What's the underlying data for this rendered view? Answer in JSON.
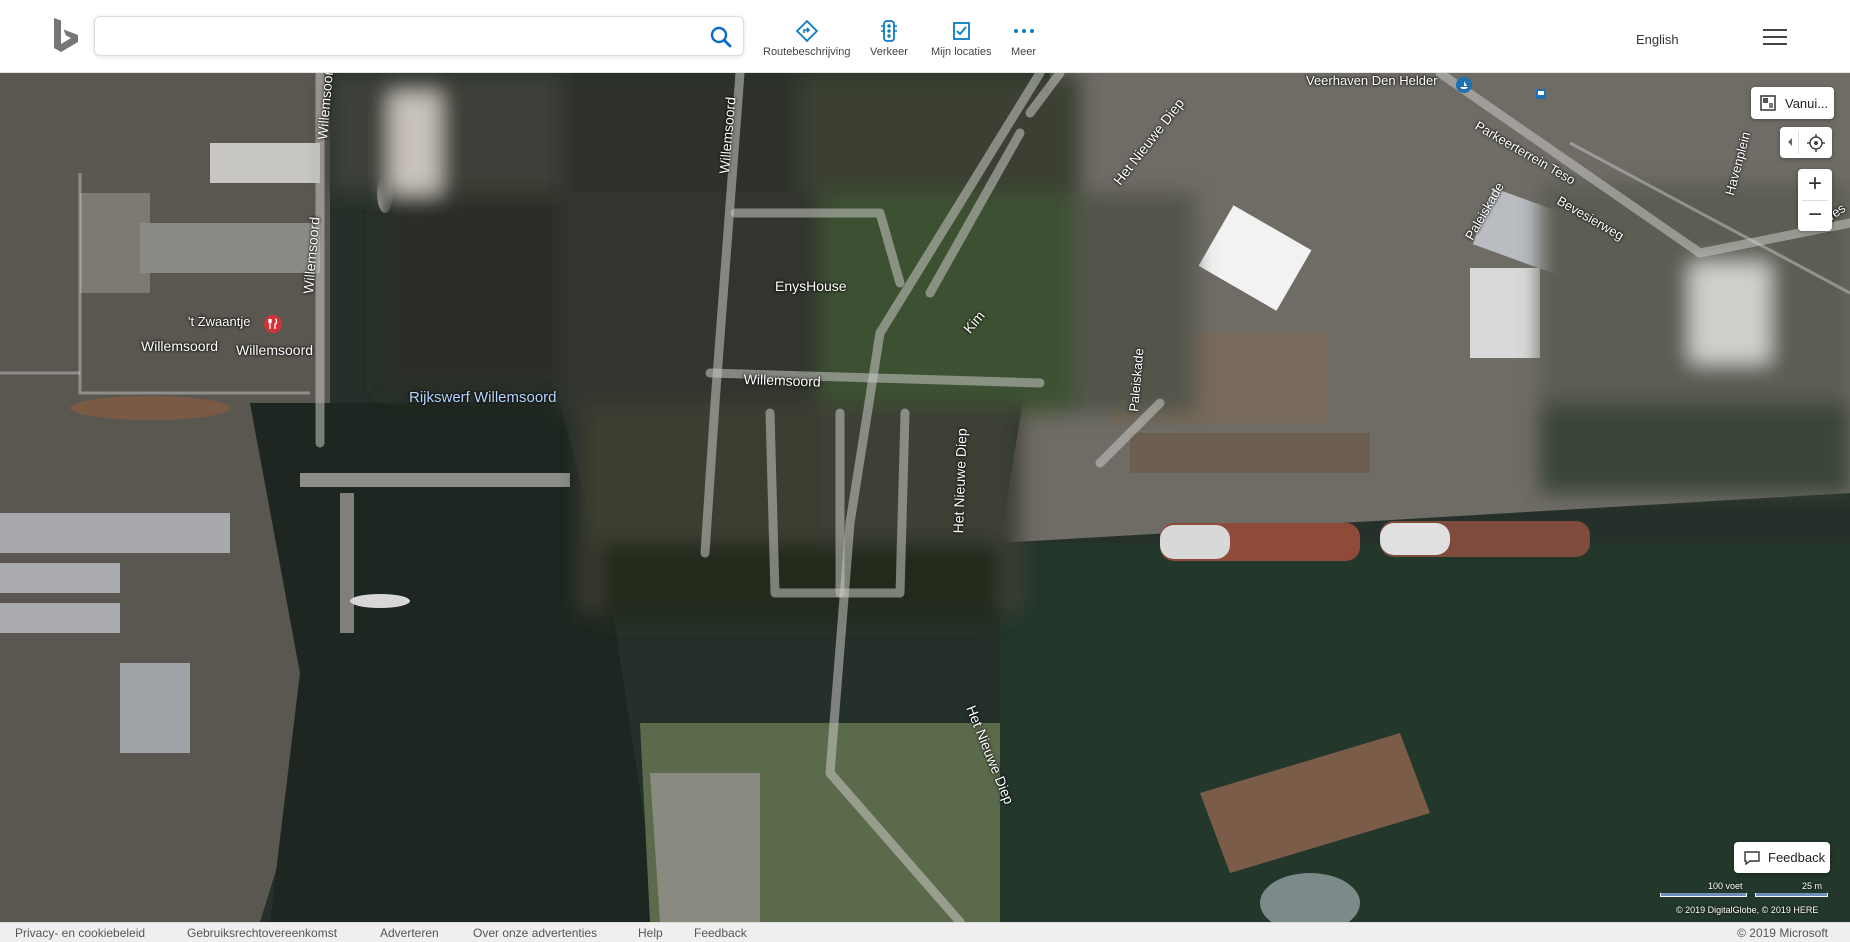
{
  "search": {
    "value": "",
    "placeholder": ""
  },
  "nav": {
    "directions_label": "Routebeschrijving",
    "traffic_label": "Verkeer",
    "my_places_label": "Mijn locaties",
    "more_label": "Meer"
  },
  "language_label": "English",
  "map": {
    "labels": {
      "veerhaven": "Veerhaven Den Helder",
      "parkeerterrein": "Parkeerterrein Teso",
      "paleiskade_1": "Paleiskade",
      "paleiskade_2": "Paleiskade",
      "bevesierweg": "Bevesierweg",
      "havenplein": "Havenplein",
      "beves_partial": "Beves",
      "het_nieuwe_diep_1": "Het Nieuwe Diep",
      "het_nieuwe_diep_2": "Het Nieuwe Diep",
      "het_nieuwe_diep_3": "Het Nieuwe Diep",
      "willemsoord_v1": "Willemsoord",
      "willemsoord_v2": "Willemsoord",
      "willemsoord_v3": "Willemsoord",
      "willemsoord_h1": "Willemsoord",
      "willemsoord_h2": "Willemsoord",
      "willemsoord_road": "Willemsoord",
      "willemsoord_v4": "Willemsoord",
      "enyshouse": "EnysHouse",
      "kim": "Kim",
      "zwaantje": "'t Zwaantje",
      "rijkswerf": "Rijkswerf Willemsoord"
    },
    "style_button_label": "Vanui...",
    "feedback_button_label": "Feedback",
    "scale": {
      "left_label": "100 voet",
      "right_label": "25 m"
    },
    "copyright": "© 2019 DigitalGlobe, © 2019 HERE"
  },
  "footer": {
    "links": [
      "Privacy- en cookiebeleid",
      "Gebruiksrechtovereenkomst",
      "Adverteren",
      "Over onze advertenties",
      "Help",
      "Feedback"
    ],
    "ms": "© 2019 Microsoft"
  }
}
